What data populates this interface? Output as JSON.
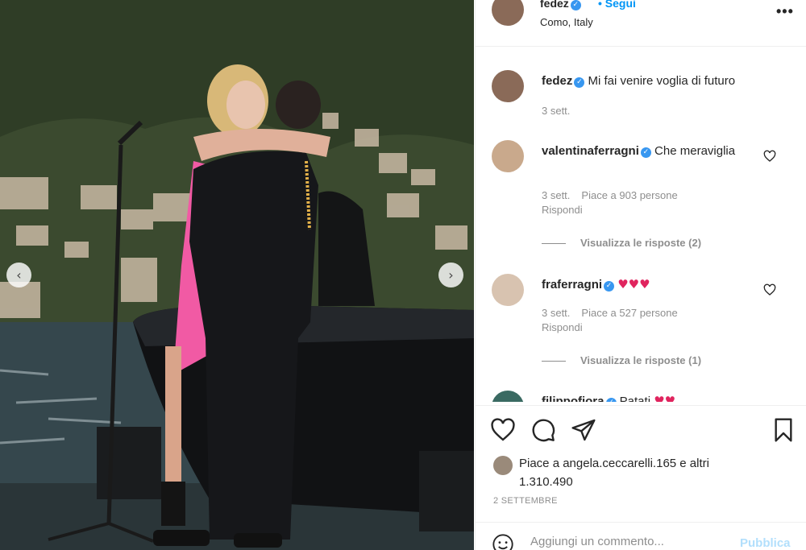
{
  "post": {
    "username": "fedez",
    "follow_label": "Segui",
    "location": "Como, Italy",
    "more_label": "•••",
    "caption": "Mi fai venire voglia di futuro",
    "caption_time": "3 sett."
  },
  "carousel": {
    "prev_icon": "chevron-left-icon",
    "next_icon": "chevron-right-icon"
  },
  "comments": [
    {
      "username": "valentinaferragni",
      "text": "Che meraviglia",
      "time": "3 sett.",
      "likes": "Piace a 903 persone",
      "reply_label": "Rispondi",
      "view_replies": "Visualizza le risposte (2)"
    },
    {
      "username": "fraferragni",
      "text": "",
      "hearts": "♥♥♥",
      "time": "3 sett.",
      "likes": "Piace a 527 persone",
      "reply_label": "Rispondi",
      "view_replies": "Visualizza le risposte (1)"
    },
    {
      "username": "filippofiora",
      "text": "Patati",
      "hearts": "♥♥"
    }
  ],
  "likes": {
    "text": "Piace a angela.ceccarelli.165 e altri 1.310.490"
  },
  "date": "2 SETTEMBRE",
  "add_comment": {
    "placeholder": "Aggiungi un commento...",
    "publish_label": "Pubblica"
  },
  "colors": {
    "verified": "#3897f0",
    "link": "#0095f6",
    "heart_red": "#e0245e"
  }
}
